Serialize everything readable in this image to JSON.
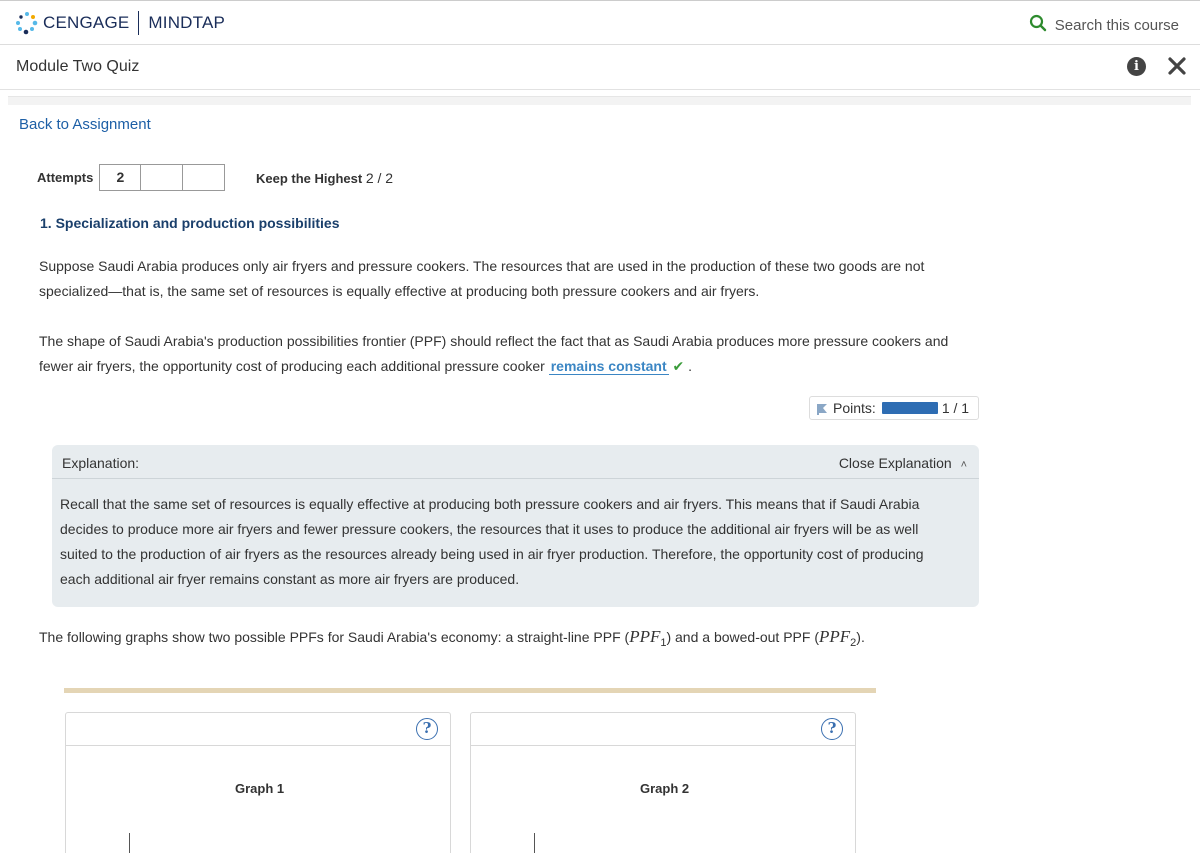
{
  "brand": {
    "name1": "CENGAGE",
    "name2": "MINDTAP"
  },
  "search": {
    "label": "Search this course"
  },
  "module": {
    "title": "Module Two Quiz"
  },
  "nav": {
    "back": "Back to Assignment"
  },
  "attempts": {
    "label": "Attempts",
    "used": "2",
    "keep_label": "Keep the Highest",
    "score": "2 / 2"
  },
  "question": {
    "title": "1. Specialization and production possibilities",
    "p1_line1": "Suppose Saudi Arabia produces only air fryers and pressure cookers. The resources that are used in the production of these two goods are not",
    "p1_line2": "specialized—that is, the same set of resources is equally effective at producing both pressure cookers and air fryers.",
    "p2_line1": "The shape of Saudi Arabia's production possibilities frontier (PPF) should reflect the fact that as Saudi Arabia produces more pressure cookers and",
    "p2_line2_pre": "fewer air fryers, the opportunity cost of producing each additional pressure cooker",
    "answer": "remains constant",
    "p2_line2_post": "."
  },
  "points": {
    "label": "Points:",
    "value": "1 / 1",
    "fill_fraction": 1.0
  },
  "explanation": {
    "header": "Explanation:",
    "close": "Close Explanation",
    "line1": "Recall that the same set of resources is equally effective at producing both pressure cookers and air fryers. This means that if Saudi Arabia",
    "line2": "decides to produce more air fryers and fewer pressure cookers, the resources that it uses to produce the additional air fryers will be as well",
    "line3": "suited to the production of air fryers as the resources already being used in air fryer production. Therefore, the opportunity cost of producing",
    "line4": "each additional air fryer remains constant as more air fryers are produced."
  },
  "graphs_intro": {
    "pre": "The following graphs show two possible PPFs for Saudi Arabia's economy: a straight-line PPF (",
    "ppf1": "PPF",
    "ppf1_sub": "1",
    "mid": ") and a bowed-out PPF (",
    "ppf2": "PPF",
    "ppf2_sub": "2",
    "post": ")."
  },
  "graphs": [
    {
      "title": "Graph 1",
      "help": "?"
    },
    {
      "title": "Graph 2",
      "help": "?"
    }
  ],
  "colors": {
    "accent": "#1d5fa6",
    "answer": "#3b86c4",
    "check": "#3a9c3a",
    "points_bar": "#2e6db3",
    "explanation_bg": "#e7ecef"
  }
}
